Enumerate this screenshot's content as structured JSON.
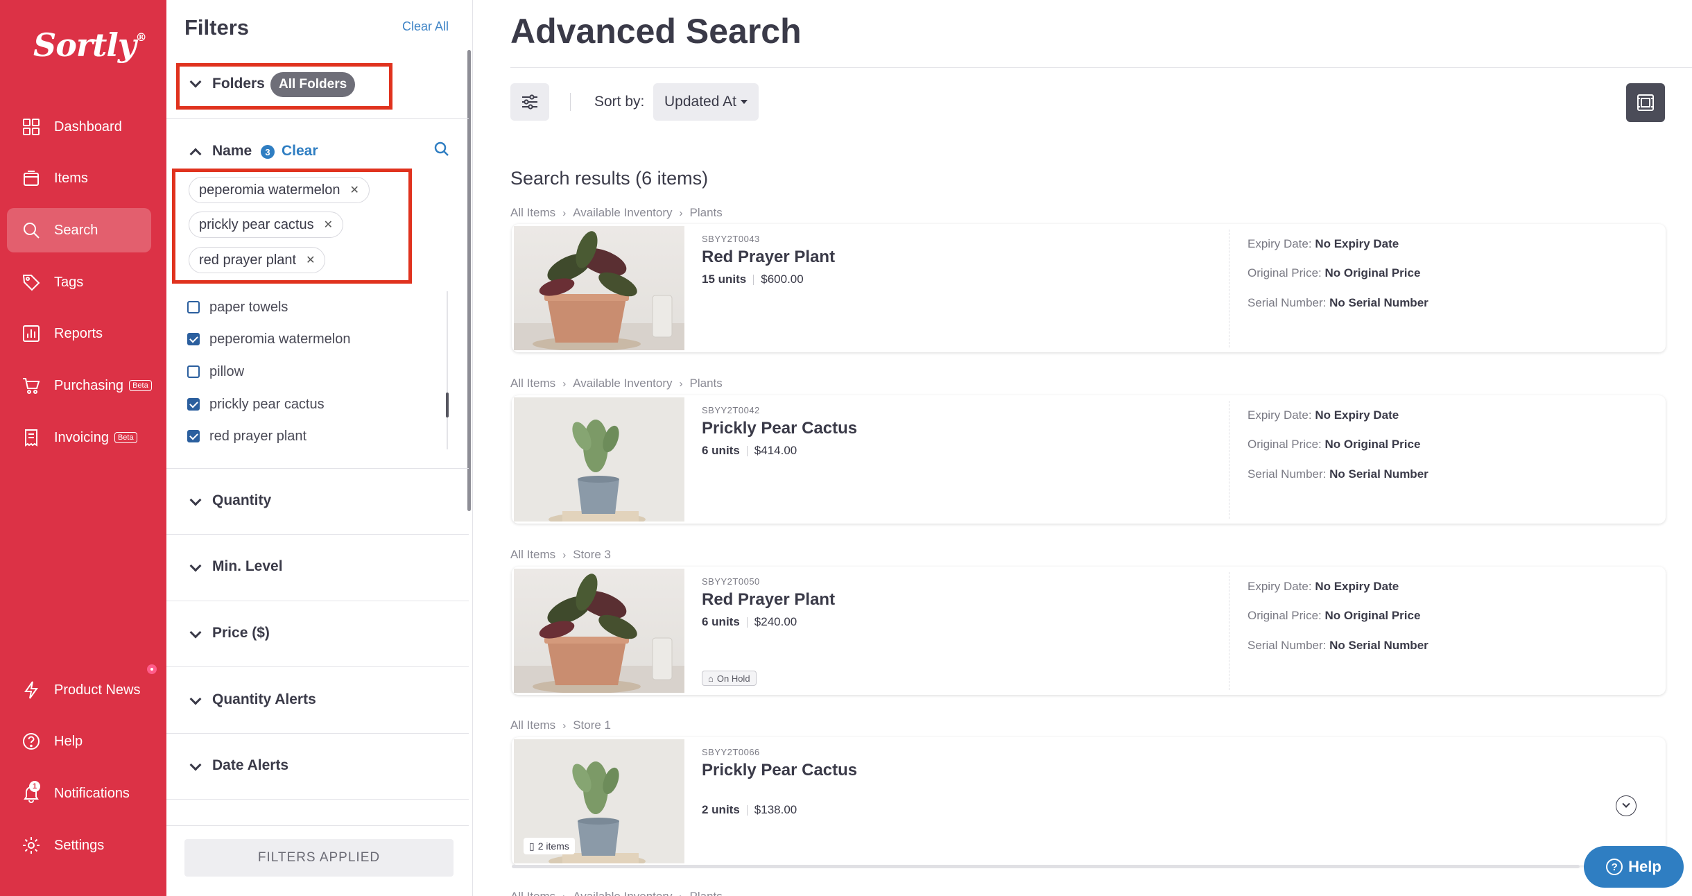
{
  "nav": {
    "logo": "Sortly",
    "logo_mark": "®",
    "items": [
      {
        "label": "Dashboard",
        "icon": "dashboard-icon"
      },
      {
        "label": "Items",
        "icon": "items-icon"
      },
      {
        "label": "Search",
        "icon": "search-icon",
        "active": true
      },
      {
        "label": "Tags",
        "icon": "tag-icon"
      },
      {
        "label": "Reports",
        "icon": "reports-icon"
      },
      {
        "label": "Purchasing",
        "icon": "purchasing-icon",
        "badge": "Beta"
      },
      {
        "label": "Invoicing",
        "icon": "invoicing-icon",
        "badge": "Beta"
      },
      {
        "label": "Product News",
        "icon": "lightning-icon"
      },
      {
        "label": "Help",
        "icon": "help-icon"
      },
      {
        "label": "Notifications",
        "icon": "bell-icon",
        "count": "1"
      },
      {
        "label": "Settings",
        "icon": "gear-icon"
      }
    ]
  },
  "filters": {
    "title": "Filters",
    "clear_all": "Clear All",
    "folders": {
      "label": "Folders",
      "value": "All Folders"
    },
    "name": {
      "label": "Name",
      "count": "3",
      "clear": "Clear",
      "chips": [
        "peperomia watermelon",
        "prickly pear cactus",
        "red prayer plant"
      ],
      "options": [
        {
          "label": "paper towels",
          "checked": false
        },
        {
          "label": "peperomia watermelon",
          "checked": true
        },
        {
          "label": "pillow",
          "checked": false
        },
        {
          "label": "prickly pear cactus",
          "checked": true
        },
        {
          "label": "red prayer plant",
          "checked": true
        }
      ]
    },
    "sections": [
      "Quantity",
      "Min. Level",
      "Price ($)",
      "Quantity Alerts",
      "Date Alerts"
    ],
    "applied_button": "FILTERS APPLIED"
  },
  "main": {
    "title": "Advanced Search",
    "sort_label": "Sort by:",
    "sort_value": "Updated At",
    "results_title": "Search results (6 items)",
    "meta_labels": {
      "expiry": "Expiry Date:",
      "price": "Original Price:",
      "serial": "Serial Number:"
    },
    "results": [
      {
        "crumbs": [
          "All Items",
          "Available Inventory",
          "Plants"
        ],
        "sku": "SBYY2T0043",
        "name": "Red Prayer Plant",
        "units": "15 units",
        "price": "$600.00",
        "image": "red-prayer-plant",
        "expiry": "No Expiry Date",
        "original_price": "No Original Price",
        "serial": "No Serial Number"
      },
      {
        "crumbs": [
          "All Items",
          "Available Inventory",
          "Plants"
        ],
        "sku": "SBYY2T0042",
        "name": "Prickly Pear Cactus",
        "units": "6 units",
        "price": "$414.00",
        "image": "prickly-pear-cactus",
        "expiry": "No Expiry Date",
        "original_price": "No Original Price",
        "serial": "No Serial Number"
      },
      {
        "crumbs": [
          "All Items",
          "Store 3"
        ],
        "sku": "SBYY2T0050",
        "name": "Red Prayer Plant",
        "units": "6 units",
        "price": "$240.00",
        "image": "red-prayer-plant",
        "tag": "On Hold",
        "expiry": "No Expiry Date",
        "original_price": "No Original Price",
        "serial": "No Serial Number"
      },
      {
        "crumbs": [
          "All Items",
          "Store 1"
        ],
        "sku": "SBYY2T0066",
        "name": "Prickly Pear Cactus",
        "units": "2 units",
        "price": "$138.00",
        "image": "prickly-pear-cactus",
        "items_badge": "2 items"
      }
    ],
    "next_crumbs": [
      "All Items",
      "Available Inventory",
      "Plants"
    ],
    "help_button": "Help"
  },
  "colors": {
    "brand": "#dc3246",
    "link": "#3f84c6",
    "highlight_box": "#e0321e",
    "checkbox": "#2b5f9e"
  }
}
